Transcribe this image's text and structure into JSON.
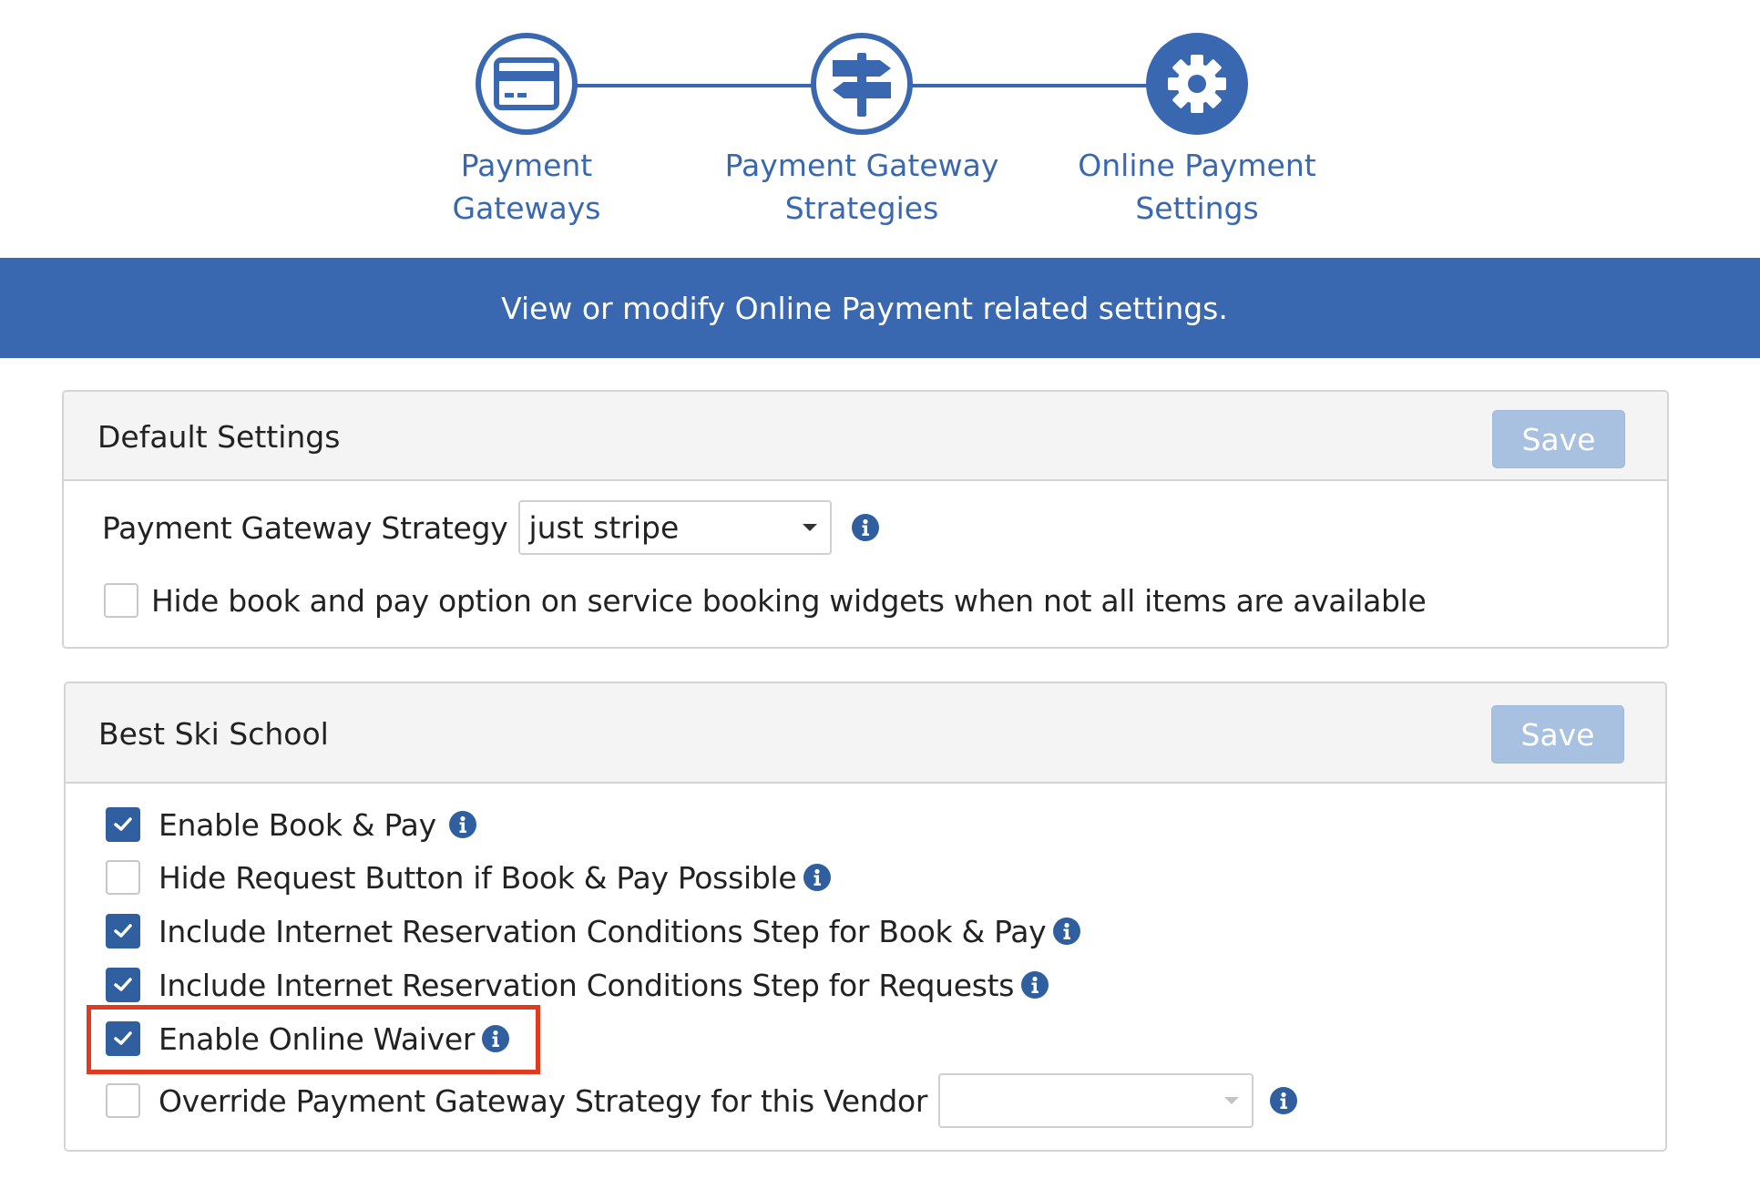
{
  "wizard": {
    "steps": [
      {
        "line1": "Payment",
        "line2": "Gateways",
        "icon": "credit-card-icon",
        "state": "complete"
      },
      {
        "line1": "Payment Gateway",
        "line2": "Strategies",
        "icon": "signpost-icon",
        "state": "complete"
      },
      {
        "line1": "Online Payment",
        "line2": "Settings",
        "icon": "gear-icon",
        "state": "active"
      }
    ]
  },
  "banner": {
    "text": "View or modify Online Payment related settings."
  },
  "default_settings": {
    "title": "Default Settings",
    "save_label": "Save",
    "strategy_label": "Payment Gateway Strategy",
    "strategy_value": "just stripe",
    "hide_book_pay_label": "Hide book and pay option on service booking widgets when not all items are available",
    "hide_book_pay_checked": false
  },
  "vendor": {
    "title": "Best Ski School",
    "save_label": "Save",
    "options": [
      {
        "label": "Enable Book & Pay",
        "checked": true
      },
      {
        "label": "Hide Request Button if Book & Pay Possible",
        "checked": false
      },
      {
        "label": "Include Internet Reservation Conditions Step for Book & Pay",
        "checked": true
      },
      {
        "label": "Include Internet Reservation Conditions Step for Requests",
        "checked": true
      },
      {
        "label": "Enable Online Waiver",
        "checked": true
      },
      {
        "label": "Override Payment Gateway Strategy for this Vendor",
        "checked": false
      }
    ],
    "override_strategy_value": ""
  },
  "colors": {
    "brand": "#3968b1",
    "checkbox_checked": "#2f5f9e",
    "save_disabled": "#a9c1e1",
    "highlight": "#e03b1f"
  }
}
